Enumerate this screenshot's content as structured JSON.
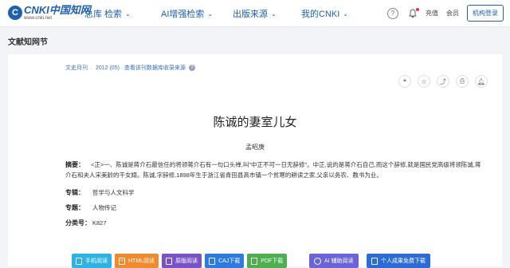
{
  "header": {
    "logo_mark": "C",
    "logo_main": "CNKI中国知网",
    "logo_sub": "www.cnki.net",
    "nav": [
      {
        "label": "总库 检索"
      },
      {
        "label": "AI增强检索"
      },
      {
        "label": "出版来源"
      },
      {
        "label": "我的CNKI"
      }
    ],
    "recharge": "充值",
    "member": "会员",
    "org_login": "机构登录"
  },
  "breadcrumb": "文献知网节",
  "article": {
    "source": "文史月刊",
    "issue": "2012 (05)",
    "indexing": "查看该刊数据库收录来源",
    "title": "陈诚的妻室儿女",
    "author": "孟昭庚",
    "abstract_label": "摘要：",
    "abstract": "<正>一、陈诚是蒋介石最信任的将领蒋介石有一句口头禅,叫\"中正不可一日无辞修\"。中正,说的是蒋介石自己,而这个辞修,就是国民党高级将领陈诚,蒋介石和夫人宋美龄的干女婿。陈诚,字辞修,1898年生于浙江省青田县高市镇一个贫寒的耕读之家,父亲以务农、教书为业。",
    "meta": [
      {
        "label": "专辑：",
        "value": "哲学与人文科学"
      },
      {
        "label": "专题：",
        "value": "人物传记"
      },
      {
        "label": "分类号：",
        "value": "K827"
      }
    ]
  },
  "actions": [
    {
      "label": "手机阅读",
      "color": "#2bb3e6"
    },
    {
      "label": "HTML阅读",
      "color": "#f08a2c"
    },
    {
      "label": "原版阅读",
      "color": "#7a52c7"
    },
    {
      "label": "CAJ下载",
      "color": "#2d7be0"
    },
    {
      "label": "PDF下载",
      "color": "#4caf50"
    }
  ],
  "ai_actions": [
    {
      "label": "AI 辅助阅读",
      "color": "#6b63d9"
    },
    {
      "label": "个人成果免费下载",
      "color": "#2d6cd6"
    }
  ],
  "colors": {
    "brand": "#1f5fb0",
    "background": "#f3f4f7"
  }
}
